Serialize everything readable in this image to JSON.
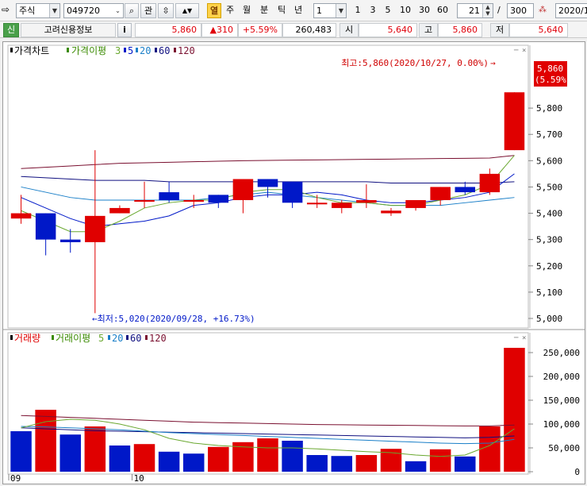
{
  "toolbar": {
    "market": "주식",
    "code": "049720",
    "btn_interest": "관",
    "tabs": [
      "열",
      "주",
      "월",
      "분",
      "틱",
      "년"
    ],
    "interval": "1",
    "quick_intervals": [
      "1",
      "3",
      "5",
      "10",
      "30",
      "60"
    ],
    "count": "21",
    "slash": "/",
    "total": "300",
    "date": "2020/1"
  },
  "infobar": {
    "credit": "신",
    "stock_name": "고려신용정보",
    "info_btn": "i",
    "price": "5,860",
    "change": "▲310",
    "change_pct": "+5.59%",
    "volume": "260,483",
    "open_label": "시",
    "open": "5,640",
    "high_label": "고",
    "high": "5,860",
    "low_label": "저",
    "low": "5,640"
  },
  "colors": {
    "up": "#e00000",
    "down": "#0018c8",
    "ma5": "#0018c8",
    "ma20": "#1a7fc8",
    "ma60": "#101080",
    "ma120": "#7a1030",
    "ma3": "#6aa830"
  },
  "chart_data": [
    {
      "type": "candlestick",
      "legend": [
        {
          "label": "가격차트",
          "color": "#000000"
        },
        {
          "label": "가격이평",
          "color": "#3a8a00"
        },
        {
          "label": "3",
          "color": "#6aa830"
        },
        {
          "label": "5",
          "color": "#0018c8"
        },
        {
          "label": "20",
          "color": "#1a7fc8"
        },
        {
          "label": "60",
          "color": "#101080"
        },
        {
          "label": "120",
          "color": "#7a1030"
        }
      ],
      "ylim": [
        5000,
        5900
      ],
      "yticks": [
        "5,800",
        "5,700",
        "5,600",
        "5,500",
        "5,400",
        "5,300",
        "5,200",
        "5,100",
        "5,000"
      ],
      "yticks_values": [
        5800,
        5700,
        5600,
        5500,
        5400,
        5300,
        5200,
        5100,
        5000
      ],
      "candles": [
        {
          "o": 5380,
          "h": 5470,
          "l": 5360,
          "c": 5400
        },
        {
          "o": 5400,
          "h": 5400,
          "l": 5240,
          "c": 5300
        },
        {
          "o": 5300,
          "h": 5340,
          "l": 5250,
          "c": 5290
        },
        {
          "o": 5290,
          "h": 5640,
          "l": 5020,
          "c": 5390
        },
        {
          "o": 5400,
          "h": 5430,
          "l": 5400,
          "c": 5420
        },
        {
          "o": 5450,
          "h": 5520,
          "l": 5420,
          "c": 5450
        },
        {
          "o": 5480,
          "h": 5520,
          "l": 5440,
          "c": 5450
        },
        {
          "o": 5450,
          "h": 5470,
          "l": 5420,
          "c": 5450
        },
        {
          "o": 5470,
          "h": 5470,
          "l": 5420,
          "c": 5440
        },
        {
          "o": 5450,
          "h": 5530,
          "l": 5400,
          "c": 5530
        },
        {
          "o": 5530,
          "h": 5530,
          "l": 5460,
          "c": 5500
        },
        {
          "o": 5520,
          "h": 5520,
          "l": 5420,
          "c": 5440
        },
        {
          "o": 5440,
          "h": 5470,
          "l": 5420,
          "c": 5440
        },
        {
          "o": 5420,
          "h": 5450,
          "l": 5400,
          "c": 5440
        },
        {
          "o": 5440,
          "h": 5510,
          "l": 5420,
          "c": 5450
        },
        {
          "o": 5400,
          "h": 5420,
          "l": 5390,
          "c": 5410
        },
        {
          "o": 5420,
          "h": 5450,
          "l": 5410,
          "c": 5450
        },
        {
          "o": 5450,
          "h": 5500,
          "l": 5430,
          "c": 5500
        },
        {
          "o": 5500,
          "h": 5520,
          "l": 5470,
          "c": 5480
        },
        {
          "o": 5480,
          "h": 5570,
          "l": 5470,
          "c": 5550
        },
        {
          "o": 5640,
          "h": 5860,
          "l": 5640,
          "c": 5860
        }
      ],
      "ma3": [
        5410,
        5370,
        5330,
        5330,
        5370,
        5420,
        5440,
        5450,
        5450,
        5480,
        5490,
        5490,
        5460,
        5440,
        5440,
        5430,
        5430,
        5450,
        5470,
        5510,
        5620
      ],
      "ma5": [
        5460,
        5420,
        5380,
        5350,
        5360,
        5370,
        5390,
        5430,
        5440,
        5460,
        5470,
        5470,
        5480,
        5470,
        5450,
        5440,
        5440,
        5450,
        5460,
        5480,
        5550
      ],
      "ma20": [
        5500,
        5480,
        5460,
        5450,
        5450,
        5450,
        5450,
        5450,
        5460,
        5470,
        5480,
        5470,
        5460,
        5450,
        5440,
        5430,
        5430,
        5430,
        5440,
        5450,
        5460
      ],
      "ma60": [
        5540,
        5535,
        5530,
        5525,
        5525,
        5525,
        5520,
        5520,
        5520,
        5520,
        5520,
        5520,
        5520,
        5520,
        5520,
        5515,
        5515,
        5515,
        5515,
        5515,
        5520
      ],
      "ma120": [
        5570,
        5575,
        5580,
        5585,
        5590,
        5592,
        5594,
        5596,
        5598,
        5600,
        5601,
        5602,
        5603,
        5604,
        5605,
        5606,
        5607,
        5608,
        5609,
        5610,
        5620
      ],
      "high_label": "최고:5,860(2020/10/27, 0.00%)",
      "low_label": "←최저:5,020(2020/09/28, +16.73%)",
      "price_tag_value": "5,860",
      "price_tag_pct": "(5.59%)"
    },
    {
      "type": "bar",
      "legend": [
        {
          "label": "거래량",
          "color": "#000000"
        },
        {
          "label": "거래이평",
          "color": "#3a8a00"
        },
        {
          "label": "5",
          "color": "#6aa830"
        },
        {
          "label": "20",
          "color": "#1a7fc8"
        },
        {
          "label": "60",
          "color": "#101080"
        },
        {
          "label": "120",
          "color": "#7a1030"
        }
      ],
      "ylim": [
        0,
        260000
      ],
      "yticks": [
        "250,000",
        "200,000",
        "150,000",
        "100,000",
        "50,000",
        "0"
      ],
      "yticks_values": [
        250000,
        200000,
        150000,
        100000,
        50000,
        0
      ],
      "values": [
        85000,
        130000,
        78000,
        95000,
        55000,
        58000,
        42000,
        38000,
        52000,
        62000,
        70000,
        65000,
        35000,
        33000,
        35000,
        48000,
        22000,
        47000,
        32000,
        95000,
        260000
      ],
      "up": [
        false,
        true,
        false,
        true,
        false,
        true,
        false,
        false,
        true,
        true,
        true,
        false,
        false,
        false,
        true,
        true,
        false,
        true,
        false,
        true,
        true
      ],
      "ma5": [
        92000,
        105000,
        110000,
        108000,
        100000,
        88000,
        70000,
        60000,
        55000,
        52000,
        50000,
        50000,
        48000,
        45000,
        42000,
        40000,
        35000,
        32000,
        35000,
        55000,
        90000
      ],
      "ma20": [
        95000,
        94000,
        92000,
        90000,
        88000,
        85000,
        82000,
        80000,
        78000,
        76000,
        74000,
        72000,
        70000,
        68000,
        66000,
        64000,
        62000,
        60000,
        59000,
        60000,
        68000
      ],
      "ma60": [
        92000,
        90000,
        88000,
        86000,
        85000,
        84000,
        83000,
        82000,
        81000,
        80000,
        79000,
        78000,
        77000,
        76000,
        75000,
        74000,
        73000,
        72000,
        71000,
        72000,
        75000
      ],
      "ma120": [
        118000,
        116000,
        114000,
        112000,
        110000,
        108000,
        106000,
        104000,
        103000,
        102000,
        101000,
        100000,
        99000,
        98500,
        98000,
        97500,
        97000,
        96500,
        96000,
        96000,
        98000
      ]
    }
  ],
  "xaxis": {
    "labels": [
      "09",
      "10"
    ],
    "label_index": [
      0,
      5
    ]
  }
}
